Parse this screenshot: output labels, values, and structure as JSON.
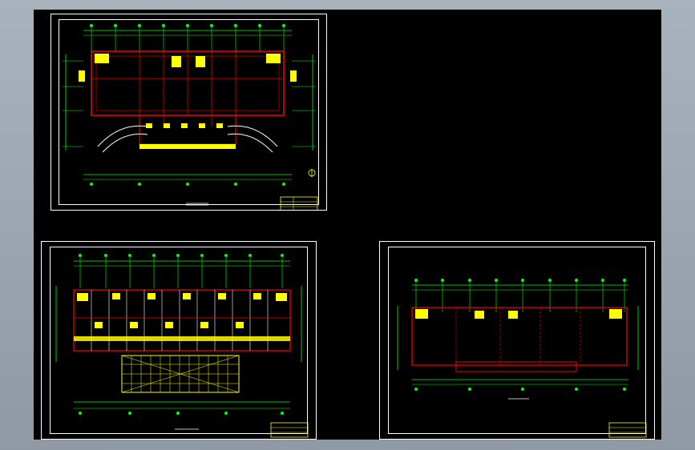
{
  "app": {
    "title": "",
    "colors": {
      "viewport_background": "#000000",
      "frame_background": "#9aa5af",
      "grid_line": "#00ff00",
      "wall": "#ff0000",
      "annotation": "#ffff00",
      "sheet_border": "#ffffff"
    }
  },
  "sheets": [
    {
      "id": "sheet-1",
      "plan": "ground-floor-plan",
      "title_text": ""
    },
    {
      "id": "sheet-2",
      "plan": "typical-floor-plan",
      "title_text": ""
    },
    {
      "id": "sheet-3",
      "plan": "roof-plan",
      "title_text": ""
    }
  ]
}
